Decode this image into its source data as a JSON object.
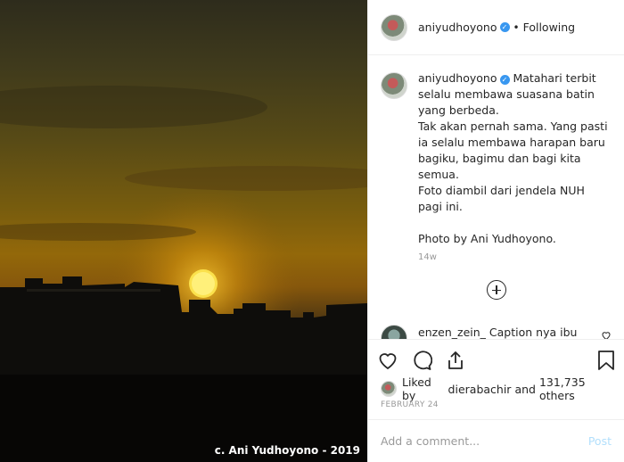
{
  "photo": {
    "credit": "c. Ani Yudhoyono - 2019"
  },
  "header": {
    "username": "aniyudhoyono",
    "separator": "•",
    "follow_status": "Following"
  },
  "caption": {
    "username": "aniyudhoyono",
    "text": "Matahari terbit selalu membawa suasana batin yang berbeda.\nTak akan pernah sama. Yang pasti ia selalu membawa harapan baru bagiku, bagimu dan bagi kita semua.\nFoto diambil dari jendela NUH pagi ini.\n\nPhoto by Ani Yudhoyono.",
    "time": "14w"
  },
  "comment": {
    "username": "enzen_zein_",
    "text": "Caption nya ibu matahari nya terbit.. tapi"
  },
  "likes": {
    "prefix": "Liked by ",
    "user": "dierabachir",
    "mid": " and ",
    "count": "131,735 others"
  },
  "date": "FEBRUARY 24",
  "add_comment": {
    "placeholder": "Add a comment...",
    "post_label": "Post"
  },
  "icons": [
    "verified-icon",
    "add-comments-icon",
    "heart-icon",
    "comment-icon",
    "share-icon",
    "bookmark-icon"
  ]
}
